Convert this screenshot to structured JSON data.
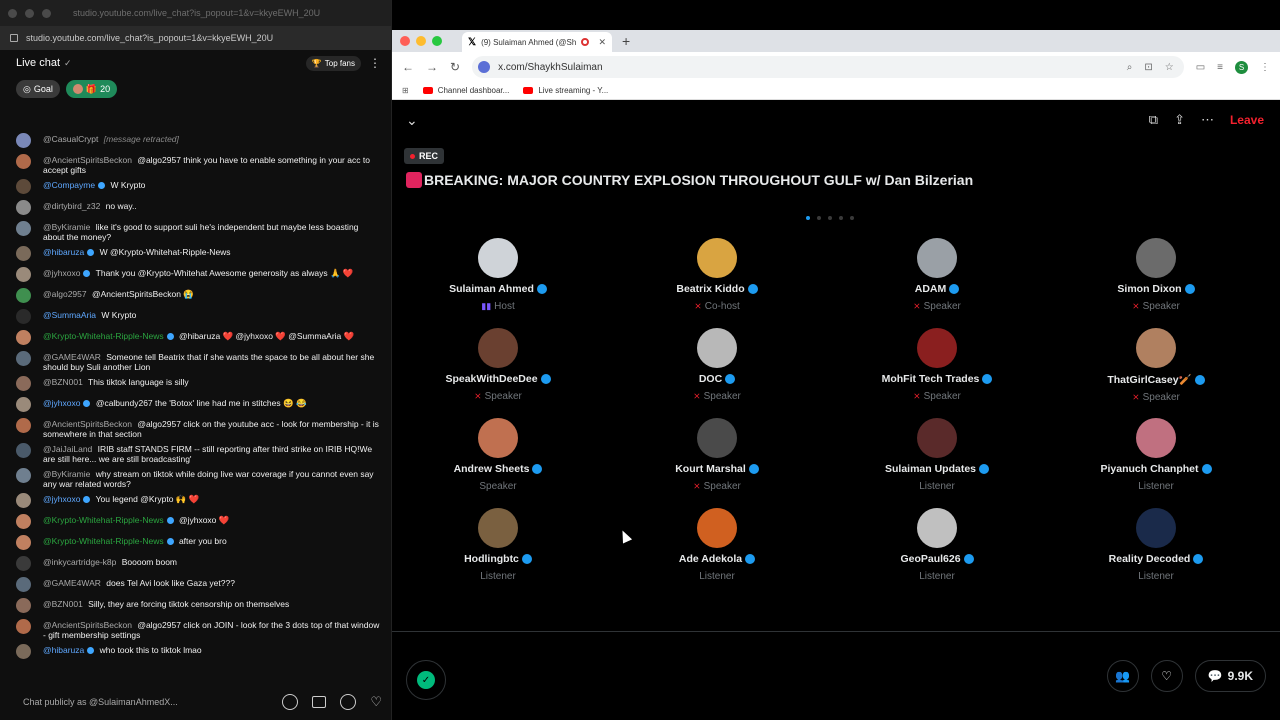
{
  "youtube": {
    "faded_url": "studio.youtube.com/live_chat?is_popout=1&v=kkyeEWH_20U",
    "address": "studio.youtube.com/live_chat?is_popout=1&v=kkyeEWH_20U",
    "live_chat_label": "Live chat",
    "top_fans_label": "Top fans",
    "goal_label": "Goal",
    "fans_count": "20",
    "input_placeholder": "Chat publicly as @SulaimanAhmedX...",
    "messages": [
      {
        "author": "@CasualCrypt",
        "text": "[message retracted]",
        "style": "gray",
        "italic": true,
        "avatar": "#7a88b8"
      },
      {
        "author": "@AncientSpiritsBeckon",
        "text": "@algo2957 think you have to enable something in your acc to accept gifts",
        "style": "gray",
        "avatar": "#b06a4a"
      },
      {
        "author": "@Compayme",
        "text": "W Krypto",
        "style": "blue",
        "badge": true,
        "avatar": "#5d4a3a"
      },
      {
        "author": "@dirtybird_z32",
        "text": "no way..",
        "style": "gray",
        "avatar": "#8a8a8a"
      },
      {
        "author": "@ByKiramie",
        "text": "like it's good to support suli he's independent but maybe less boasting about the money?",
        "style": "gray",
        "avatar": "#6f7f8f"
      },
      {
        "author": "@hibaruza",
        "text": "W @Krypto-Whitehat-Ripple-News",
        "style": "blue",
        "badge": true,
        "avatar": "#7a6a5a"
      },
      {
        "author": "@jyhxoxo",
        "text": "Thank you @Krypto-Whitehat Awesome generosity as always 🙏 ❤️",
        "style": "gray",
        "badge": true,
        "avatar": "#9a8a7a"
      },
      {
        "author": "@algo2957",
        "text": "@AncientSpiritsBeckon 😭",
        "style": "gray",
        "avatar": "#3f8f4f"
      },
      {
        "author": "@SummaAria",
        "text": "W Krypto",
        "style": "blue",
        "avatar": "#2a2a2a"
      },
      {
        "author": "@Krypto-Whitehat-Ripple-News",
        "text": "@hibaruza ❤️ @jyhxoxo ❤️ @SummaAria ❤️",
        "style": "green",
        "badge": true,
        "avatar": "#c08060"
      },
      {
        "author": "@GAME4WAR",
        "text": "Someone tell Beatrix that if she wants the space to be all about her she should buy Suli another Lion",
        "style": "gray",
        "avatar": "#5a6a7a"
      },
      {
        "author": "@BZN001",
        "text": "This tiktok language is silly",
        "style": "gray",
        "avatar": "#8a6a5a"
      },
      {
        "author": "@jyhxoxo",
        "text": "@calbundy267 the 'Botox' line had me in stitches 😆 😂",
        "style": "blue",
        "badge": true,
        "avatar": "#9a8a7a"
      },
      {
        "author": "@AncientSpiritsBeckon",
        "text": "@algo2957 click on the youtube acc - look for membership - it is somewhere in that section",
        "style": "gray",
        "avatar": "#b06a4a"
      },
      {
        "author": "@JaiJaiLand",
        "text": "IRIB staff STANDS FIRM -- still reporting after third strike on IRIB HQ!We are still here... we are still broadcasting'",
        "style": "gray",
        "avatar": "#4a5a6a"
      },
      {
        "author": "@ByKiramie",
        "text": "why stream on tiktok while doing live war coverage if you cannot even say any war related words?",
        "style": "gray",
        "avatar": "#6f7f8f"
      },
      {
        "author": "@jyhxoxo",
        "text": "You legend @Krypto 🙌 ❤️",
        "style": "blue",
        "badge": true,
        "avatar": "#9a8a7a"
      },
      {
        "author": "@Krypto-Whitehat-Ripple-News",
        "text": "@jyhxoxo ❤️",
        "style": "green",
        "badge": true,
        "avatar": "#c08060"
      },
      {
        "author": "@Krypto-Whitehat-Ripple-News",
        "text": "after you bro",
        "style": "green",
        "badge": true,
        "avatar": "#c08060"
      },
      {
        "author": "@inkycartridge-k8p",
        "text": "Boooom boom",
        "style": "gray",
        "avatar": "#3a3a3a"
      },
      {
        "author": "@GAME4WAR",
        "text": "does Tel Avi look like Gaza yet???",
        "style": "gray",
        "avatar": "#5a6a7a"
      },
      {
        "author": "@BZN001",
        "text": "Silly, they are forcing tiktok censorship on themselves",
        "style": "gray",
        "avatar": "#8a6a5a"
      },
      {
        "author": "@AncientSpiritsBeckon",
        "text": "@algo2957 click on JOIN - look for the 3 dots top of that window - gift membership settings",
        "style": "gray",
        "avatar": "#b06a4a"
      },
      {
        "author": "@hibaruza",
        "text": "who took this to tiktok lmao",
        "style": "blue",
        "badge": true,
        "avatar": "#7a6a5a"
      }
    ]
  },
  "browser": {
    "tab_title": "(9) Sulaiman Ahmed (@Sh",
    "url": "x.com/ShaykhSulaiman",
    "profile_initial": "S",
    "bookmarks": [
      "Channel dashboar...",
      "Live streaming - Y..."
    ]
  },
  "space": {
    "rec_label": "REC",
    "title": "BREAKING: MAJOR COUNTRY EXPLOSION THROUGHOUT GULF w/ Dan Bilzerian",
    "leave_label": "Leave",
    "listener_count": "9.9K",
    "participants": [
      {
        "name": "Sulaiman Ahmed",
        "role": "Host",
        "kind": "host",
        "avatar": "#cfd3d8"
      },
      {
        "name": "Beatrix Kiddo",
        "role": "Co-host",
        "kind": "muted",
        "avatar": "#d9a441"
      },
      {
        "name": "ADAM",
        "role": "Speaker",
        "kind": "muted",
        "avatar": "#9aa0a6"
      },
      {
        "name": "Simon Dixon",
        "role": "Speaker",
        "kind": "muted",
        "avatar": "#6b6b6b"
      },
      {
        "name": "SpeakWithDeeDee",
        "role": "Speaker",
        "kind": "muted",
        "avatar": "#6a4030"
      },
      {
        "name": "DOC",
        "role": "Speaker",
        "kind": "muted",
        "avatar": "#b8b8b8"
      },
      {
        "name": "MohFit Tech Trades",
        "role": "Speaker",
        "kind": "muted",
        "avatar": "#8a1f1f"
      },
      {
        "name": "ThatGirlCasey🏏",
        "role": "Speaker",
        "kind": "muted",
        "avatar": "#b08060"
      },
      {
        "name": "Andrew Sheets",
        "role": "Speaker",
        "kind": "plain",
        "avatar": "#c07050"
      },
      {
        "name": "Kourt Marshal",
        "role": "Speaker",
        "kind": "muted",
        "avatar": "#4a4a4a"
      },
      {
        "name": "Sulaiman Updates",
        "role": "Listener",
        "kind": "plain",
        "avatar": "#5a2a2a"
      },
      {
        "name": "Piyanuch Chanphet",
        "role": "Listener",
        "kind": "plain",
        "avatar": "#c07080"
      },
      {
        "name": "Hodlingbtc",
        "role": "Listener",
        "kind": "plain",
        "avatar": "#7a6040"
      },
      {
        "name": "Ade Adekola",
        "role": "Listener",
        "kind": "plain",
        "avatar": "#d06020"
      },
      {
        "name": "GeoPaul626",
        "role": "Listener",
        "kind": "plain",
        "avatar": "#c0c0c0"
      },
      {
        "name": "Reality Decoded",
        "role": "Listener",
        "kind": "plain",
        "avatar": "#1a2a4a"
      }
    ]
  }
}
